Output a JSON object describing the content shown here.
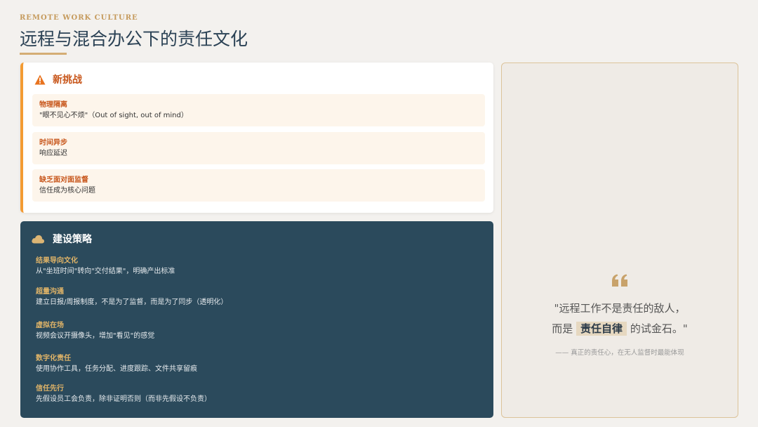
{
  "header": {
    "eyebrow": "REMOTE WORK CULTURE",
    "title": "远程与混合办公下的责任文化"
  },
  "challenges": {
    "title": "新挑战",
    "icon": "warning-icon",
    "items": [
      {
        "title": "物理隔离",
        "desc": "\"眼不见心不烦\"（Out of sight, out of mind）"
      },
      {
        "title": "时间异步",
        "desc": "响应延迟"
      },
      {
        "title": "缺乏面对面监督",
        "desc": "信任成为核心问题"
      }
    ]
  },
  "strategies": {
    "title": "建设策略",
    "icon": "cloud-icon",
    "items": [
      {
        "title": "结果导向文化",
        "desc": "从\"坐班时间\"转向\"交付结果\"，明确产出标准"
      },
      {
        "title": "超量沟通",
        "desc": "建立日报/周报制度，不是为了监督，而是为了同步（透明化）"
      },
      {
        "title": "虚拟在场",
        "desc": "视频会议开摄像头，增加\"看见\"的感觉"
      },
      {
        "title": "数字化责任",
        "desc": "使用协作工具，任务分配、进度跟踪、文件共享留痕"
      },
      {
        "title": "信任先行",
        "desc": "先假设员工会负责，除非证明否则（而非先假设不负责）"
      }
    ]
  },
  "quote": {
    "icon": "quote-icon",
    "line1": "\"远程工作不是责任的敌人，",
    "line2_pre": "而是",
    "line2_highlight": "责任自律",
    "line2_post": "的试金石。\"",
    "attribution": "—— 真正的责任心，在无人监督时最能体现"
  },
  "colors": {
    "accent": "#d4ad74",
    "warning": "#c8571c",
    "navy": "#2b4a5c"
  }
}
